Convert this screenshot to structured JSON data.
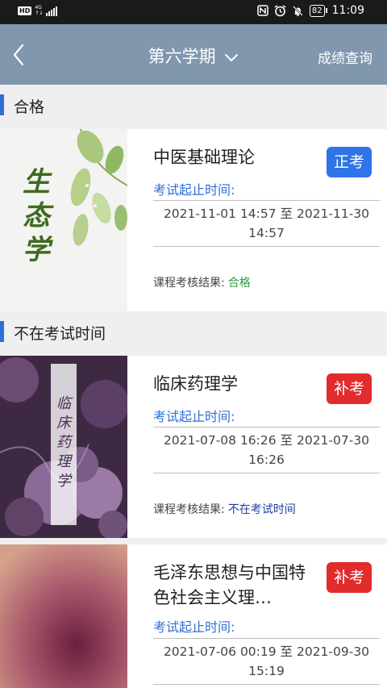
{
  "status_bar": {
    "hd": "HD",
    "network": "4G",
    "battery": "82",
    "time": "11:09"
  },
  "navbar": {
    "title": "第六学期",
    "right_link": "成绩查询"
  },
  "sections": [
    {
      "label": "合格",
      "courses": [
        {
          "title": "中医基础理论",
          "badge": "正考",
          "badge_color": "#2f74e8",
          "time_label": "考试起止时间:",
          "time_range": "2021-11-01 14:57 至 2021-11-30 14:57",
          "result_label": "课程考核结果:",
          "result_value": "合格",
          "result_color": "#2a9a3a",
          "cover_text": "生态学"
        }
      ]
    },
    {
      "label": "不在考试时间",
      "courses": [
        {
          "title": "临床药理学",
          "badge": "补考",
          "badge_color": "#e22b2b",
          "time_label": "考试起止时间:",
          "time_range": "2021-07-08 16:26 至 2021-07-30 16:26",
          "result_label": "课程考核结果:",
          "result_value": "不在考试时间",
          "result_color": "#1f3fa3",
          "cover_text": "临床药理学"
        },
        {
          "title": "毛泽东思想与中国特色社会主义理…",
          "badge": "补考",
          "badge_color": "#e22b2b",
          "time_label": "考试起止时间:",
          "time_range": "2021-07-06 00:19 至 2021-09-30 15:19"
        }
      ]
    }
  ]
}
